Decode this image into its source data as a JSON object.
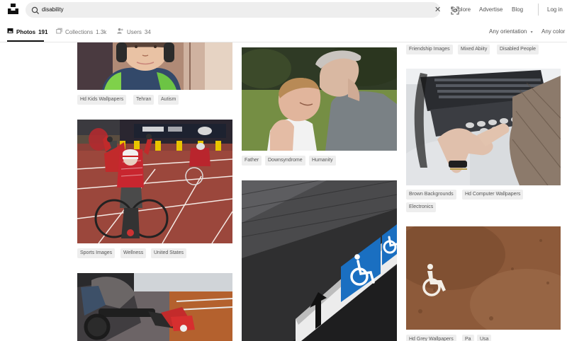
{
  "search": {
    "query": "disability"
  },
  "nav": {
    "explore": "Explore",
    "advertise": "Advertise",
    "blog": "Blog",
    "login": "Log in"
  },
  "tabs": [
    {
      "label": "Photos",
      "count": "191"
    },
    {
      "label": "Collections",
      "count": "1.3k"
    },
    {
      "label": "Users",
      "count": "34"
    }
  ],
  "filters": {
    "orientation": "Any orientation",
    "color": "Any color"
  },
  "columns": [
    [
      {
        "alt": "child with headphones",
        "tags": [
          "Hd Kids Wallpapers",
          "Tehran",
          "Autism"
        ]
      },
      {
        "alt": "wheelchair racers on a track",
        "tags": [
          "Sports Images",
          "Wellness",
          "United States"
        ]
      },
      {
        "alt": "person in a power wheelchair",
        "tags": []
      }
    ],
    [
      {
        "alt": "father and son embracing",
        "tags": [
          "Father",
          "Downsyndrome",
          "Humanity"
        ]
      },
      {
        "alt": "accessible sign with arrow",
        "tags": []
      }
    ],
    [
      {
        "alt": "",
        "tags": [
          "Friendship Images",
          "Mixed Abiity",
          "Disabled People"
        ]
      },
      {
        "alt": "hands on a braille keyboard",
        "tags": [
          "Brown Backgrounds",
          "Hd Computer Wallpapers",
          "Electronics"
        ]
      },
      {
        "alt": "wheelchair symbol on brown ground",
        "tags": [
          "Hd Grey Wallpapers",
          "Pa",
          "Usa"
        ]
      }
    ]
  ],
  "colors": {
    "accent": "#111111",
    "tag_bg": "#eeeeee",
    "wheelchair_blue": "#1a6fc1"
  },
  "icons": [
    "unsplash-logo-icon",
    "search-icon",
    "close-icon",
    "visual-search-icon",
    "photo-icon",
    "collections-icon",
    "users-icon",
    "chevron-down-icon"
  ]
}
